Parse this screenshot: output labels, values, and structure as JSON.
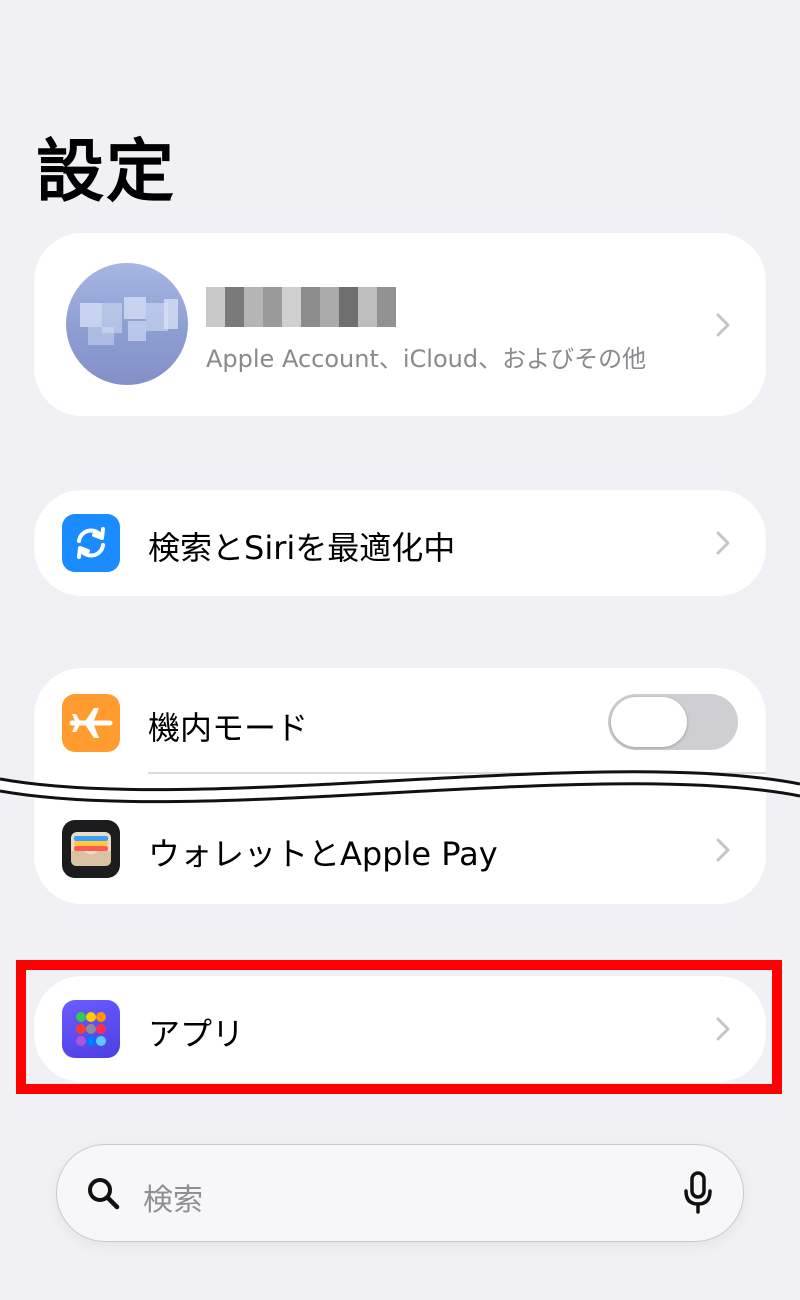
{
  "page": {
    "title": "設定"
  },
  "profile": {
    "subtitle": "Apple Account、iCloud、およびその他",
    "name_redacted": true
  },
  "rows": {
    "search_siri": {
      "label": "検索とSiriを最適化中",
      "icon": "sync-arrows-icon",
      "icon_color": "#1a8cff"
    },
    "airplane": {
      "label": "機内モード",
      "icon": "airplane-icon",
      "icon_color": "#ff9b2f",
      "toggle_on": false
    },
    "wallet": {
      "label": "ウォレットとApple Pay",
      "icon": "wallet-icon",
      "icon_color": "#1c1c1e"
    },
    "apps": {
      "label": "アプリ",
      "icon": "apps-grid-icon",
      "icon_color": "#5b4cf0"
    }
  },
  "annotation": {
    "highlight_color": "#ff0000",
    "highlighted_item": "apps"
  },
  "search": {
    "placeholder": "検索",
    "icons": [
      "search-icon",
      "microphone-icon"
    ]
  }
}
